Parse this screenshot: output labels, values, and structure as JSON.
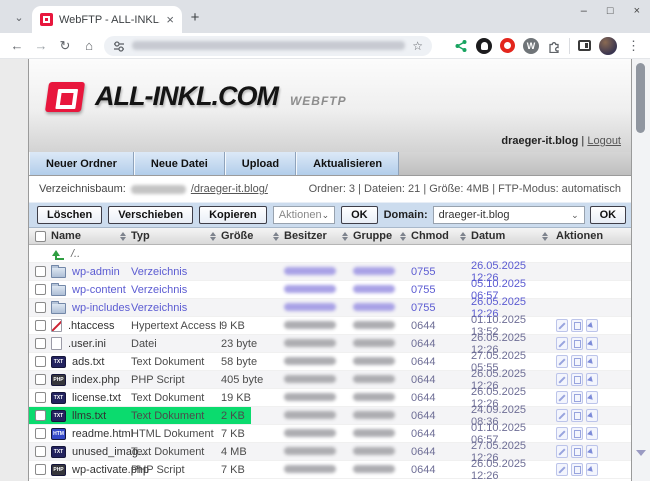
{
  "colors": {
    "highlight_green": "#0bdb6e",
    "brand_red": "#e8173d"
  },
  "icons": {
    "tab_search": "⌄",
    "tab_close": "×",
    "new_tab": "+",
    "minimize": "–",
    "maximize": "□",
    "close": "×",
    "back": "←",
    "forward": "→",
    "reload": "↻",
    "home": "⌂",
    "star": "☆",
    "menu": "⋮",
    "wordpress": "W",
    "select_chevron": "⌄"
  },
  "browser": {
    "tab_title": "WebFTP - ALL-INKL.COM"
  },
  "site": {
    "logo_text": "ALL-INKL.COM",
    "logo_sub": "WEBFTP",
    "account": "draeger-it.blog",
    "sep": "|",
    "logout_label": "Logout",
    "toolbar": [
      "Neuer Ordner",
      "Neue Datei",
      "Upload",
      "Aktualisieren"
    ],
    "tree_label": "Verzeichnisbaum:",
    "tree_path": "/draeger-it.blog/",
    "stats": "Ordner: 3 | Dateien: 21 | Größe: 4MB | FTP-Modus: automatisch",
    "actions": {
      "buttons": [
        "Löschen",
        "Verschieben",
        "Kopieren"
      ],
      "select_placeholder": "Aktionen",
      "ok_label": "OK",
      "domain_label": "Domain:",
      "domain_value": "draeger-it.blog"
    }
  },
  "table": {
    "columns": [
      "Name",
      "Typ",
      "Größe",
      "Besitzer",
      "Gruppe",
      "Chmod",
      "Datum",
      "Aktionen"
    ],
    "icon_labels": {
      "text-file": "TXT",
      "php-file": "PHP",
      "html-file": "HTM"
    },
    "rows": [
      {
        "icon": "parent-up",
        "kind": "up",
        "check": false,
        "name": "/..",
        "typ": "",
        "groesse": "",
        "chmod": "",
        "datum": "",
        "actions": false,
        "highlight": false
      },
      {
        "icon": "folder",
        "kind": "dir",
        "check": true,
        "name": "wp-admin",
        "typ": "Verzeichnis",
        "groesse": "",
        "chmod": "0755",
        "datum": "26.05.2025 12:26",
        "actions": false,
        "highlight": false
      },
      {
        "icon": "folder",
        "kind": "dir",
        "check": true,
        "name": "wp-content",
        "typ": "Verzeichnis",
        "groesse": "",
        "chmod": "0755",
        "datum": "05.10.2025 06:57",
        "actions": false,
        "highlight": false
      },
      {
        "icon": "folder",
        "kind": "dir",
        "check": true,
        "name": "wp-includes",
        "typ": "Verzeichnis",
        "groesse": "",
        "chmod": "0755",
        "datum": "26.05.2025 12:26",
        "actions": false,
        "highlight": false
      },
      {
        "icon": "htaccess-file",
        "kind": "file",
        "check": true,
        "name": ".htaccess",
        "typ": "Hypertext Access Dok...",
        "groesse": "9 KB",
        "chmod": "0644",
        "datum": "01.10.2025 13:52",
        "actions": true,
        "highlight": false
      },
      {
        "icon": "generic-file",
        "kind": "file",
        "check": true,
        "name": ".user.ini",
        "typ": "Datei",
        "groesse": "23 byte",
        "chmod": "0644",
        "datum": "26.05.2025 12:26",
        "actions": true,
        "highlight": false
      },
      {
        "icon": "text-file",
        "kind": "file",
        "check": true,
        "name": "ads.txt",
        "typ": "Text Dokument",
        "groesse": "58 byte",
        "chmod": "0644",
        "datum": "27.05.2025 05:55",
        "actions": true,
        "highlight": false
      },
      {
        "icon": "php-file",
        "kind": "file",
        "check": true,
        "name": "index.php",
        "typ": "PHP Script",
        "groesse": "405 byte",
        "chmod": "0644",
        "datum": "26.05.2025 12:26",
        "actions": true,
        "highlight": false
      },
      {
        "icon": "text-file",
        "kind": "file",
        "check": true,
        "name": "license.txt",
        "typ": "Text Dokument",
        "groesse": "19 KB",
        "chmod": "0644",
        "datum": "26.05.2025 12:26",
        "actions": true,
        "highlight": false
      },
      {
        "icon": "text-file",
        "kind": "file",
        "check": true,
        "name": "llms.txt",
        "typ": "Text Dokument",
        "groesse": "2 KB",
        "chmod": "0644",
        "datum": "24.09.2025 08:36",
        "actions": true,
        "highlight": true
      },
      {
        "icon": "html-file",
        "kind": "file",
        "check": true,
        "name": "readme.html",
        "typ": "HTML Dokument",
        "groesse": "7 KB",
        "chmod": "0644",
        "datum": "01.10.2025 06:57",
        "actions": true,
        "highlight": false
      },
      {
        "icon": "text-file",
        "kind": "file",
        "check": true,
        "name": "unused_imag...",
        "typ": "Text Dokument",
        "groesse": "4 MB",
        "chmod": "0644",
        "datum": "27.05.2025 12:26",
        "actions": true,
        "highlight": false
      },
      {
        "icon": "php-file",
        "kind": "file",
        "check": true,
        "name": "wp-activate.php",
        "typ": "PHP Script",
        "groesse": "7 KB",
        "chmod": "0644",
        "datum": "26.05.2025 12:26",
        "actions": true,
        "highlight": false
      }
    ]
  }
}
